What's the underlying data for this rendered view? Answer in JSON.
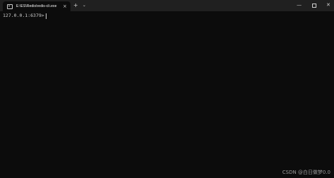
{
  "window": {
    "tab_title": "E:\\ES\\Redis\\redis-cli.exe",
    "close_tab_glyph": "×",
    "new_tab_glyph": "+",
    "dropdown_glyph": "⌄",
    "minimize_glyph": "—",
    "close_window_glyph": "✕"
  },
  "terminal": {
    "prompt": "127.0.0.1:6379>",
    "input_value": "",
    "background": "#0c0c0c",
    "foreground": "#cccccc"
  },
  "watermark": "CSDN @白日做梦0.0",
  "icons": [
    "terminal-icon",
    "close-icon",
    "plus-icon",
    "chevron-down-icon",
    "minimize-icon",
    "maximize-icon",
    "close-icon"
  ]
}
